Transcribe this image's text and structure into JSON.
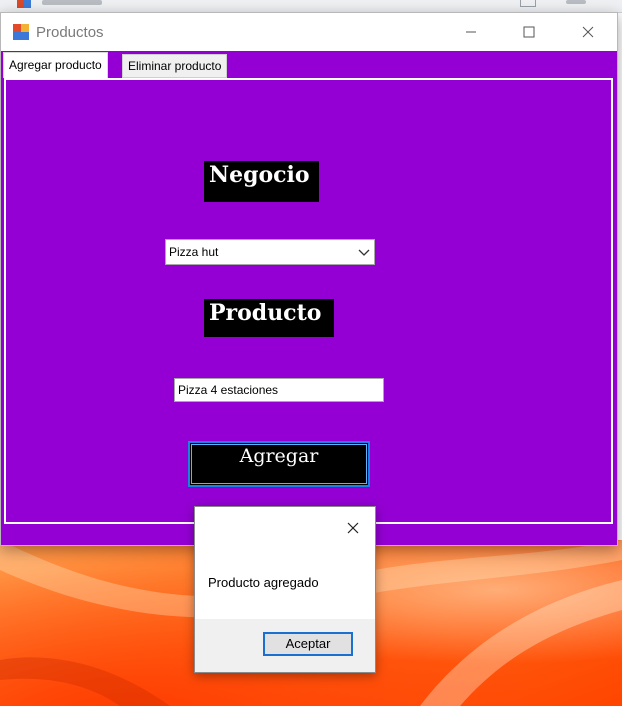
{
  "window": {
    "title": "Productos",
    "controls": {
      "minimize": "minimize-icon",
      "maximize": "maximize-icon",
      "close": "close-icon"
    }
  },
  "tabs": [
    {
      "label": "Agregar producto",
      "active": true
    },
    {
      "label": "Eliminar producto",
      "active": false
    }
  ],
  "form": {
    "negocio_heading": "Negocio",
    "negocio_selected": "Pizza hut",
    "producto_heading": "Producto",
    "producto_value": "Pizza 4 estaciones",
    "agregar_label": "Agregar"
  },
  "message_box": {
    "text": "Producto agregado",
    "ok_label": "Aceptar"
  },
  "colors": {
    "form_background": "#9400d3",
    "heading_background": "#000000",
    "button_border": "#1a82e2"
  }
}
